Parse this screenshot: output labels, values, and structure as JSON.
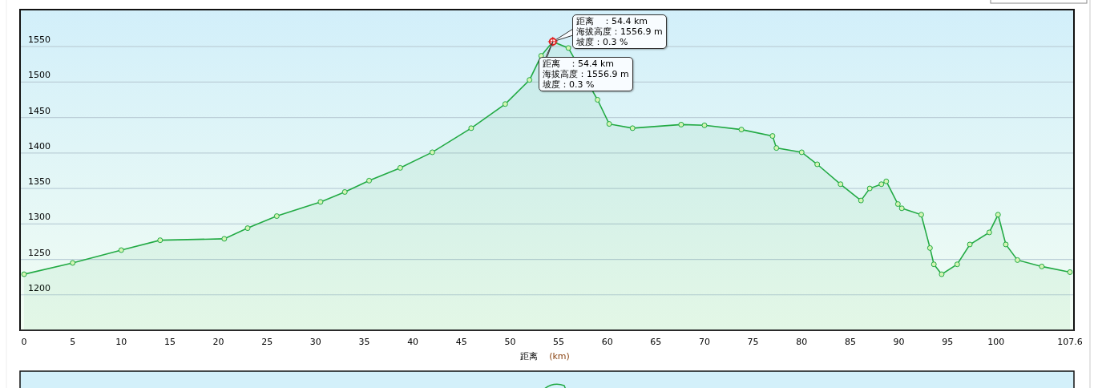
{
  "chart": {
    "chart_data": {
      "type": "area",
      "xlabel": "距离",
      "grid": true,
      "x": [
        0,
        5,
        10,
        14,
        20.6,
        23,
        26,
        30.5,
        33,
        35.5,
        38.7,
        42,
        46,
        49.5,
        52,
        53.2,
        54.4,
        56,
        59,
        60.2,
        62.6,
        67.6,
        70,
        73.8,
        77,
        77.4,
        80,
        81.6,
        84,
        86.1,
        87,
        88.2,
        88.7,
        89.9,
        90.3,
        92.3,
        93.2,
        93.6,
        94.4,
        96,
        97.3,
        99.3,
        100.2,
        101,
        102.2,
        104.7,
        107.6
      ],
      "series": [
        {
          "color": "#22aa44",
          "marker": "circle",
          "values": [
            1229,
            1245,
            1263,
            1277,
            1279,
            1294,
            1311,
            1331,
            1345,
            1361,
            1379,
            1401,
            1435,
            1469,
            1503,
            1537,
            1557,
            1548,
            1475,
            1441,
            1435,
            1440,
            1439,
            1433,
            1424,
            1407,
            1401,
            1384,
            1356,
            1333,
            1350,
            1356,
            1360,
            1328,
            1322,
            1313,
            1266,
            1243,
            1229,
            1243,
            1271,
            1288,
            1313,
            1271,
            1249,
            1240,
            1232
          ]
        }
      ],
      "xlim": [
        0,
        107.6
      ],
      "ylim": [
        1150,
        1601
      ],
      "xticks": [
        0,
        5,
        10,
        15,
        20,
        25,
        30,
        35,
        40,
        45,
        50,
        55,
        60,
        65,
        70,
        75,
        80,
        85,
        90,
        95,
        100,
        107.6
      ],
      "yticks": [
        1200,
        1250,
        1300,
        1350,
        1400,
        1450,
        1500,
        1550
      ]
    },
    "xlabel_unit": "(km)",
    "tooltips": [
      {
        "lines": [
          "距离　：54.4 km",
          "海拔高度：1556.9 m",
          "坡度：0.3 %"
        ]
      },
      {
        "lines": [
          "距离　：54.4 km",
          "海拔高度：1556.9 m",
          "坡度：0.3 %"
        ]
      }
    ]
  }
}
